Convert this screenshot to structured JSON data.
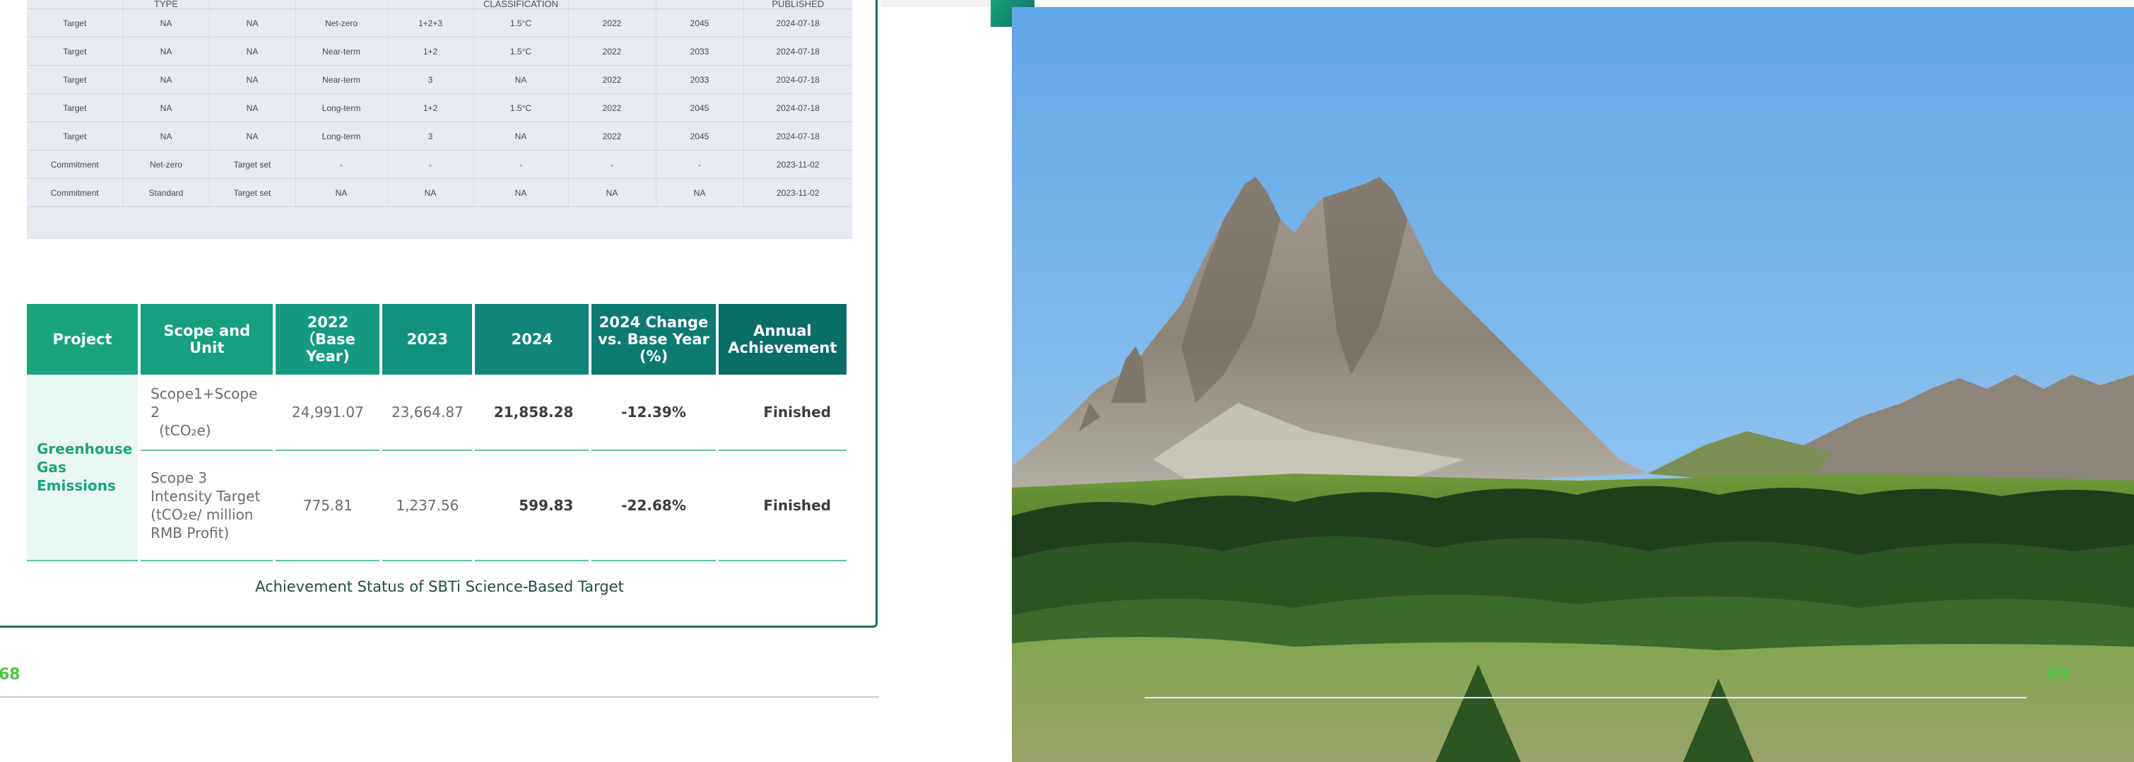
{
  "sbti_table": {
    "header": [
      "",
      "TYPE",
      "",
      "",
      "",
      "CLASSIFICATION",
      "",
      "",
      "PUBLISHED"
    ],
    "rows": [
      [
        "Target",
        "NA",
        "NA",
        "Net-zero",
        "1+2+3",
        "1.5°C",
        "2022",
        "2045",
        "2024-07-18"
      ],
      [
        "Target",
        "NA",
        "NA",
        "Near-term",
        "1+2",
        "1.5°C",
        "2022",
        "2033",
        "2024-07-18"
      ],
      [
        "Target",
        "NA",
        "NA",
        "Near-term",
        "3",
        "NA",
        "2022",
        "2033",
        "2024-07-18"
      ],
      [
        "Target",
        "NA",
        "NA",
        "Long-term",
        "1+2",
        "1.5°C",
        "2022",
        "2045",
        "2024-07-18"
      ],
      [
        "Target",
        "NA",
        "NA",
        "Long-term",
        "3",
        "NA",
        "2022",
        "2045",
        "2024-07-18"
      ],
      [
        "Commitment",
        "Net-zero",
        "Target set",
        "-",
        "-",
        "-",
        "-",
        "-",
        "2023-11-02"
      ],
      [
        "Commitment",
        "Standard",
        "Target set",
        "NA",
        "NA",
        "NA",
        "NA",
        "NA",
        "2023-11-02"
      ]
    ]
  },
  "achievement_table": {
    "headers": {
      "project": "Project",
      "scope": "Scope and Unit",
      "y2022": "2022（Base Year)",
      "y2023": "2023",
      "y2024": "2024",
      "change": "2024 Change vs. Base Year (%)",
      "annual": "Annual Achievement"
    },
    "project": "Greenhouse Gas Emissions",
    "rows": [
      {
        "scope_main": "Scope1+Scope 2",
        "scope_unit": "(tCO₂e)",
        "y2022": "24,991.07",
        "y2023": "23,664.87",
        "y2024": "21,858.28",
        "change": "-12.39%",
        "annual": "Finished"
      },
      {
        "scope_main": "Scope 3 Intensity Target (tCO₂e/ million RMB Profit)",
        "y2022": "775.81",
        "y2023": "1,237.56",
        "y2024": "599.83",
        "change": "-22.68%",
        "annual": "Finished"
      }
    ],
    "header_colors": [
      "#1aa37f",
      "#169f80",
      "#149a80",
      "#12927e",
      "#0f8679",
      "#0d7a72",
      "#0b6d68"
    ]
  },
  "caption": "Achievement Status of SBTi Science-Based Target",
  "page_left": "68",
  "page_right": "69",
  "colors": {
    "accent_green": "#1aa37f",
    "page_number": "#4cc642",
    "frame": "#1c6e63"
  }
}
